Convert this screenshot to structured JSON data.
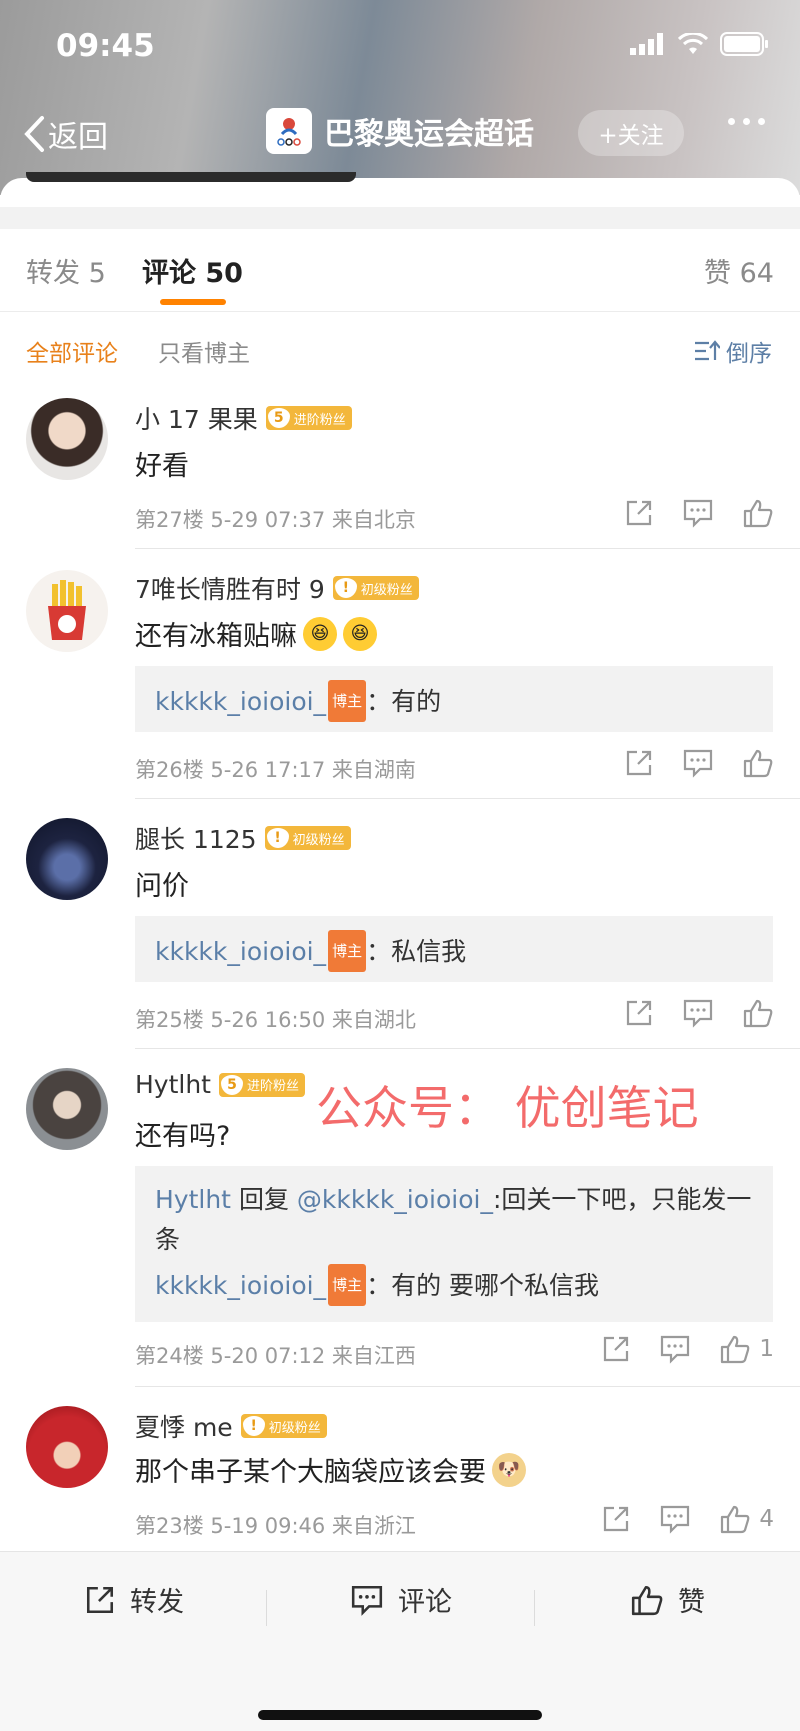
{
  "status": {
    "time": "09:45"
  },
  "nav": {
    "back_label": "返回",
    "title": "巴黎奥运会超话",
    "follow_label": "+关注"
  },
  "tabs": {
    "repost": "转发 5",
    "comments": "评论 50",
    "likes": "赞 64"
  },
  "filters": {
    "all": "全部评论",
    "author_only": "只看博主",
    "sort": "倒序"
  },
  "watermark": "公众号：  优创笔记",
  "comments": [
    {
      "user": "小 17 果果",
      "badge_level": "5",
      "badge_text": "进阶粉丝",
      "text": "好看",
      "meta": "第27楼  5-29 07:37  来自北京",
      "like_count": ""
    },
    {
      "user": "7唯长情胜有时 9",
      "badge_level": "!",
      "badge_text": "初级粉丝",
      "text": "还有冰箱贴嘛",
      "reply_user": "kkkkk_ioioioi_",
      "reply_tag": "博主",
      "reply_text": "：有的",
      "meta": "第26楼  5-26 17:17  来自湖南",
      "like_count": ""
    },
    {
      "user": "腿长 1125",
      "badge_level": "!",
      "badge_text": "初级粉丝",
      "text": "问价",
      "reply_user": "kkkkk_ioioioi_",
      "reply_tag": "博主",
      "reply_text": "：私信我",
      "meta": "第25楼  5-26 16:50  来自湖北",
      "like_count": ""
    },
    {
      "user": "Hytlht",
      "badge_level": "5",
      "badge_text": "进阶粉丝",
      "text": "还有吗?",
      "reply1_user": "Hytlht",
      "reply1_mid": " 回复 ",
      "reply1_at": "@kkkkk_ioioioi_",
      "reply1_text": ":回关一下吧，只能发一条",
      "reply2_user": "kkkkk_ioioioi_",
      "reply2_tag": "博主",
      "reply2_text": "：有的 要哪个私信我",
      "meta": "第24楼  5-20 07:12  来自江西",
      "like_count": "1"
    },
    {
      "user": "夏悸 me",
      "badge_level": "!",
      "badge_text": "初级粉丝",
      "text": "那个串子某个大脑袋应该会要",
      "meta": "第23楼  5-19 09:46  来自浙江",
      "like_count": "4"
    }
  ],
  "bottom_bar": {
    "repost": "转发",
    "comment": "评论",
    "like": "赞"
  }
}
